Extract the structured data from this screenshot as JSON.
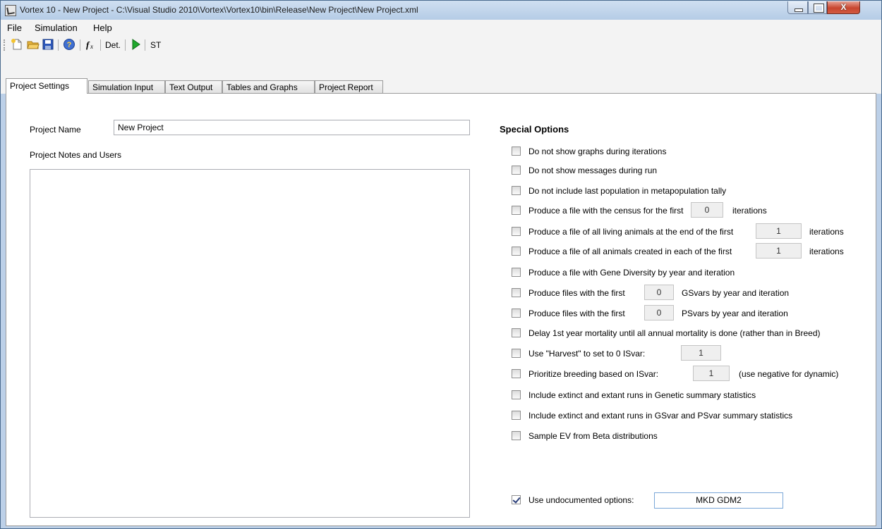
{
  "window": {
    "title": "Vortex 10 - New Project - C:\\Visual Studio 2010\\Vortex\\Vortex10\\bin\\Release\\New Project\\New Project.xml",
    "close_glyph": "X"
  },
  "menu": [
    "File",
    "Simulation",
    "Help"
  ],
  "toolbar": {
    "det_label": "Det.",
    "st_label": "ST"
  },
  "tabs": [
    "Project Settings",
    "Simulation Input",
    "Text Output",
    "Tables and Graphs",
    "Project Report"
  ],
  "project": {
    "name_label": "Project Name",
    "name_value": "New Project",
    "notes_label": "Project Notes and Users",
    "notes_value": ""
  },
  "special": {
    "title": "Special Options",
    "options": [
      {
        "label": "Do not show graphs during iterations",
        "checked": false
      },
      {
        "label": "Do not show messages during run",
        "checked": false
      },
      {
        "label": "Do not include last population in metapopulation tally",
        "checked": false
      },
      {
        "label": "Produce a file with the census for the first",
        "checked": false,
        "value": "0",
        "suffix": "iterations"
      },
      {
        "label": "Produce a file of all living animals at the end of the first",
        "checked": false,
        "value": "1",
        "suffix": "iterations"
      },
      {
        "label": "Produce a file of all animals created in each of the first",
        "checked": false,
        "value": "1",
        "suffix": "iterations"
      },
      {
        "label": "Produce a file with Gene Diversity by year and iteration",
        "checked": false
      },
      {
        "label": "Produce files with the first",
        "checked": false,
        "value": "0",
        "suffix": "GSvars by year and iteration"
      },
      {
        "label": "Produce files with the first",
        "checked": false,
        "value": "0",
        "suffix": "PSvars by year and iteration"
      },
      {
        "label": "Delay 1st year mortality until all annual mortality is done (rather than in Breed)",
        "checked": false
      },
      {
        "label": "Use \"Harvest\" to set to 0 ISvar:",
        "checked": false,
        "value": "1"
      },
      {
        "label": "Prioritize breeding based on ISvar:",
        "checked": false,
        "value": "1",
        "suffix": "(use negative for dynamic)"
      },
      {
        "label": "Include extinct and extant runs in Genetic summary statistics",
        "checked": false
      },
      {
        "label": "Include extinct and extant runs in GSvar and PSvar summary statistics",
        "checked": false
      },
      {
        "label": "Sample EV from Beta distributions",
        "checked": false
      }
    ],
    "undocumented": {
      "label": "Use undocumented options:",
      "checked": true,
      "value": "MKD GDM2"
    }
  }
}
